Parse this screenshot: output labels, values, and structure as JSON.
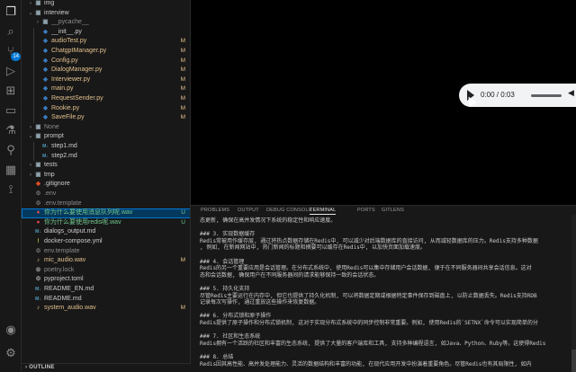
{
  "activity_bar": {
    "icons": [
      "explorer-icon",
      "search-icon",
      "source-control-icon",
      "run-debug-icon",
      "extensions-icon",
      "remote-explorer-icon",
      "testing-icon",
      "flask-icon",
      "docker-icon",
      "git-graph-icon",
      "account-icon",
      "settings-gear-icon"
    ],
    "source_control_badge": "14"
  },
  "explorer": {
    "rows": [
      {
        "name": "img",
        "type": "folder",
        "depth": 1,
        "expanded": false,
        "status": ""
      },
      {
        "name": "interview",
        "type": "folder",
        "depth": 1,
        "expanded": true,
        "status": ""
      },
      {
        "name": "__pycache__",
        "type": "folder",
        "depth": 2,
        "expanded": false,
        "status": ""
      },
      {
        "name": "__init__.py",
        "type": "py",
        "depth": 2,
        "status": ""
      },
      {
        "name": "audioTest.py",
        "type": "py",
        "depth": 2,
        "status": "M"
      },
      {
        "name": "ChatgptManager.py",
        "type": "py",
        "depth": 2,
        "status": "M"
      },
      {
        "name": "Config.py",
        "type": "py",
        "depth": 2,
        "status": "M"
      },
      {
        "name": "DialogManager.py",
        "type": "py",
        "depth": 2,
        "status": "M"
      },
      {
        "name": "Interviewer.py",
        "type": "py",
        "depth": 2,
        "status": "M"
      },
      {
        "name": "main.py",
        "type": "py",
        "depth": 2,
        "status": "M"
      },
      {
        "name": "RequestSender.py",
        "type": "py",
        "depth": 2,
        "status": "M"
      },
      {
        "name": "Rookie.py",
        "type": "py",
        "depth": 2,
        "status": "M"
      },
      {
        "name": "SaveFile.py",
        "type": "py",
        "depth": 2,
        "status": "M"
      },
      {
        "name": "None",
        "type": "folder",
        "depth": 1,
        "expanded": false,
        "status": ""
      },
      {
        "name": "prompt",
        "type": "folder",
        "depth": 1,
        "expanded": true,
        "status": ""
      },
      {
        "name": "step1.md",
        "type": "md",
        "depth": 2,
        "status": ""
      },
      {
        "name": "step2.md",
        "type": "md",
        "depth": 2,
        "status": ""
      },
      {
        "name": "tests",
        "type": "folder",
        "depth": 1,
        "expanded": false,
        "status": ""
      },
      {
        "name": "tmp",
        "type": "folder",
        "depth": 1,
        "expanded": false,
        "status": ""
      },
      {
        "name": ".gitignore",
        "type": "git",
        "depth": 1,
        "status": ""
      },
      {
        "name": ".env",
        "type": "env",
        "depth": 1,
        "status": ""
      },
      {
        "name": ".env.template",
        "type": "env",
        "depth": 1,
        "status": ""
      },
      {
        "name": "你为什么要使用消息队列呢.wav",
        "type": "wav-red",
        "depth": 1,
        "status": "U",
        "selected": true
      },
      {
        "name": "你为什么要使用redis呢.wav",
        "type": "wav-red",
        "depth": 1,
        "status": "U"
      },
      {
        "name": "dialogs_output.md",
        "type": "md",
        "depth": 1,
        "status": ""
      },
      {
        "name": "docker-compose.yml",
        "type": "yml",
        "depth": 1,
        "status": ""
      },
      {
        "name": "env.template",
        "type": "env",
        "depth": 1,
        "status": ""
      },
      {
        "name": "mic_audio.wav",
        "type": "wav",
        "depth": 1,
        "status": "M"
      },
      {
        "name": "poetry.lock",
        "type": "lock",
        "depth": 1,
        "status": ""
      },
      {
        "name": "pyproject.toml",
        "type": "toml",
        "depth": 1,
        "status": ""
      },
      {
        "name": "README_EN.md",
        "type": "md",
        "depth": 1,
        "status": ""
      },
      {
        "name": "README.md",
        "type": "md",
        "depth": 1,
        "status": ""
      },
      {
        "name": "system_audio.wav",
        "type": "wav",
        "depth": 1,
        "status": "M"
      }
    ],
    "outline_label": "OUTLINE"
  },
  "audio": {
    "time": "0:00 / 0:03"
  },
  "panel": {
    "tabs": [
      "PROBLEMS",
      "OUTPUT",
      "DEBUG CONSOLE",
      "TERMINAL",
      "PORTS",
      "GITLENS"
    ],
    "active_tab": "TERMINAL",
    "lines": [
      "态更新, 确保在高并发情况下系统的稳定性和响应速度。",
      "",
      "### 3. 实现数据缓存",
      "Redis常被用作缓存层, 通过将热点数据存储在Redis中, 可以减少对后端数据库的直接访问, 从而减轻数据库的压力。Redis支持多种数据",
      ", 例如, 在新闻网站中, 热门新闻的标题和摘要可以缓存在Redis中, 以加快页面加载速度。",
      "",
      "### 4. 会话管理",
      "Redis的另一个重要应用是会话管理。在分布式系统中, 使用Redis可以集中存储用户会话数据, 便于在不同服务器间共享会话信息。这对",
      "态和会话数据, 确保用户在不同服务器间的请求能够保持一致的会话状态。",
      "",
      "### 5. 持久化支持",
      "尽管Redis主要运行在内存中, 但它也提供了持久化机制, 可以将数据定期或根据特定事件保存到磁盘上, 以防止数据丢失。Redis支持RDB",
      "记录每次写操作, 通过重放这些操作来恢复数据。",
      "",
      "### 6. 分布式锁和原子操作",
      "Redis提供了原子操作和分布式锁机制, 这对于实现分布式系统中的同步控制非常重要。例如, 使用Redis的`SETNX`命令可以实现简单的分",
      "",
      "### 7. 社区和生态系统",
      "Redis拥有一个活跃的社区和丰富的生态系统, 提供了大量的客户端库和工具, 支持多种编程语言, 如Java、Python、Ruby等。这使得Redis",
      "",
      "### 8. 总结",
      "Redis因其高性能、高并发处理能力、灵活的数据结构和丰富的功能, 在现代应用开发中扮演着重要角色。尽管Redis也有其局限性, 如内"
    ]
  },
  "colors": {
    "accent": "#0078d4",
    "modified": "#e2c08d",
    "untracked": "#73c991",
    "python_blue": "#3b7bbf",
    "python_yellow": "#f2c94c",
    "wav_red": "#e5484d"
  }
}
